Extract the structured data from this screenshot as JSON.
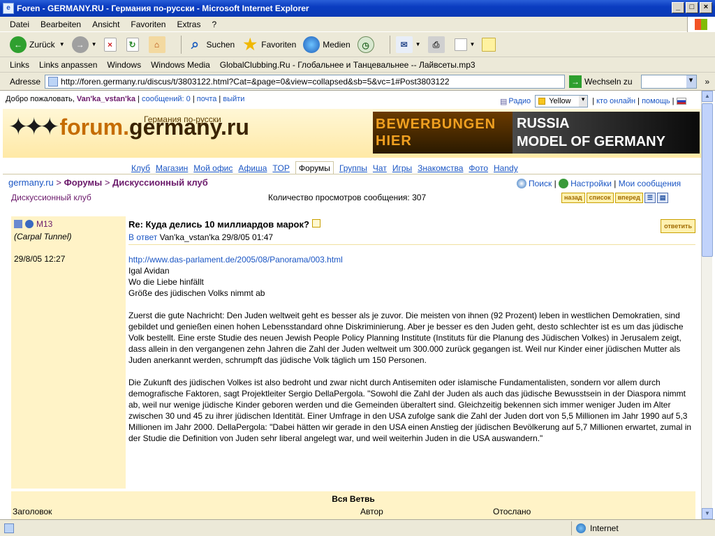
{
  "window": {
    "title": "Foren - GERMANY.RU - Германия по-русски - Microsoft Internet Explorer"
  },
  "menu": [
    "Datei",
    "Bearbeiten",
    "Ansicht",
    "Favoriten",
    "Extras",
    "?"
  ],
  "toolbar": {
    "back": "Zurück",
    "search": "Suchen",
    "favorites": "Favoriten",
    "media": "Medien"
  },
  "links": {
    "label": "Links",
    "items": [
      "Links anpassen",
      "Windows",
      "Windows Media",
      "GlobalClubbing.Ru - Глобальнее и Танцевальнее -- Лайвсеты.mp3"
    ]
  },
  "address": {
    "label": "Adresse",
    "url": "http://foren.germany.ru/discus/t/3803122.html?Cat=&page=0&view=collapsed&sb=5&vc=1#Post3803122",
    "go": "Wechseln zu"
  },
  "status": {
    "zone": "Internet"
  },
  "site": {
    "welcome": "Добро пожаловать,",
    "user": "Van'ka_vstan'ka",
    "messages": "сообщений: 0",
    "mail": "почта",
    "logout": "выйти",
    "radio": "Радио",
    "skin": "Yellow",
    "online": "кто онлайн",
    "help": "помощь",
    "logo_sub": "Германия по-русски",
    "logo_a": "forum.",
    "logo_b": "germany.ru",
    "banner_l1": "BEWERBUNGEN",
    "banner_l2": "HIER",
    "banner_r1": "RUSSIA",
    "banner_r2": "MODEL OF GERMANY",
    "nav": [
      "Клуб",
      "Магазин",
      "Мой офис",
      "Афиша",
      "TOP",
      "Форумы",
      "Группы",
      "Чат",
      "Игры",
      "Знакомства",
      "Фото",
      "Handy"
    ],
    "crumb_home": "germany.ru",
    "crumb_forums": "Форумы",
    "crumb_club": "Дискуссионный клуб",
    "search": "Поиск",
    "settings": "Настройки",
    "my_messages": "Мои сообщения",
    "forum_name": "Дискуссионный клуб",
    "views": "Количество просмотров сообщения: 307",
    "btn_back": "назад",
    "btn_list": "список",
    "btn_next": "вперед"
  },
  "post": {
    "author": "M13",
    "author_title": "(Carpal Tunnel)",
    "date": "29/8/05 12:27",
    "subject": "Re: Куда делись 10 миллиардов марок?",
    "reply_btn": "ответить",
    "in_reply_link": "В ответ",
    "in_reply_rest": " Van'ka_vstan'ka 29/8/05 01:47",
    "url": "http://www.das-parlament.de/2005/08/Panorama/003.html",
    "line1": "Igal Avidan",
    "line2": "Wo die Liebe hinfällt",
    "line3": "Größe des jüdischen Volks nimmt ab",
    "p1": "Zuerst die gute Nachricht: Den Juden weltweit geht es besser als je zuvor. Die meisten von ihnen (92 Prozent) leben in westlichen Demokratien, sind gebildet und genießen einen hohen Lebensstandard ohne Diskriminierung. Aber je besser es den Juden geht, desto schlechter ist es um das jüdische Volk bestellt. Eine erste Studie des neuen Jewish People Policy Planning Institute (Instituts für die Planung des Jüdischen Volkes) in Jerusalem zeigt, dass allein in den vergangenen zehn Jahren die Zahl der Juden weltweit um 300.000 zurück gegangen ist. Weil nur Kinder einer jüdischen Mutter als Juden anerkannt werden, schrumpft das jüdische Volk täglich um 150 Personen.",
    "p2": "Die Zukunft des jüdischen Volkes ist also bedroht und zwar nicht durch Antisemiten oder islamische Fundamentalisten, sondern vor allem durch demografische Faktoren, sagt Projektleiter Sergio DellaPergola. \"Sowohl die Zahl der Juden als auch das jüdische Bewusstsein in der Diaspora nimmt ab, weil nur wenige jüdische Kinder geboren werden und die Gemeinden überaltert sind. Gleichzeitig bekennen sich immer weniger Juden im Alter zwischen 30 und 45 zu ihrer jüdischen Identität. Einer Umfrage in den USA zufolge sank die Zahl der Juden dort von 5,5 Millionen im Jahr 1990 auf 5,3 Millionen im Jahr 2000. DellaPergola: \"Dabei hätten wir gerade in den USA einen Anstieg der jüdischen Bevölkerung auf 5,7 Millionen erwartet, zumal in der Studie die Definition von Juden sehr liberal angelegt war, und weil weiterhin Juden in die USA auswandern.\""
  },
  "thread": {
    "title": "Вся Ветвь",
    "col_title": "Заголовок",
    "col_author": "Автор",
    "col_sent": "Отослано"
  }
}
